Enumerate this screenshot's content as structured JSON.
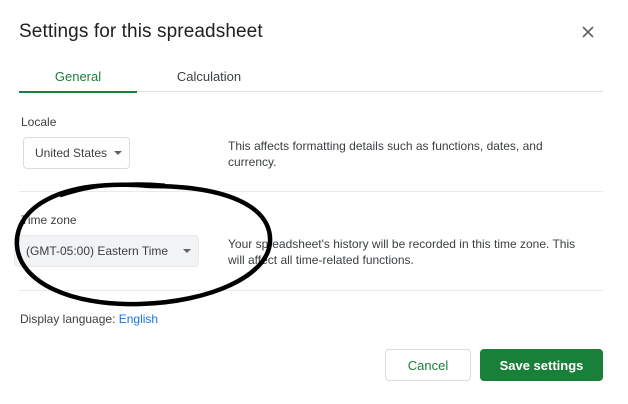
{
  "dialog": {
    "title": "Settings for this spreadsheet",
    "close_icon": "close-icon"
  },
  "tabs": [
    {
      "label": "General",
      "active": true
    },
    {
      "label": "Calculation",
      "active": false
    }
  ],
  "locale": {
    "label": "Locale",
    "value": "United States",
    "description": "This affects formatting details such as functions, dates, and currency."
  },
  "time_zone": {
    "label": "Time zone",
    "value": "(GMT-05:00) Eastern Time",
    "description": "Your spreadsheet's history will be recorded in this time zone. This will affect all time-related functions."
  },
  "display_language": {
    "label": "Display language:",
    "value": "English"
  },
  "buttons": {
    "cancel": "Cancel",
    "save": "Save settings"
  },
  "colors": {
    "accent": "#188038",
    "link": "#1a73e8",
    "annotation": "#000000"
  }
}
